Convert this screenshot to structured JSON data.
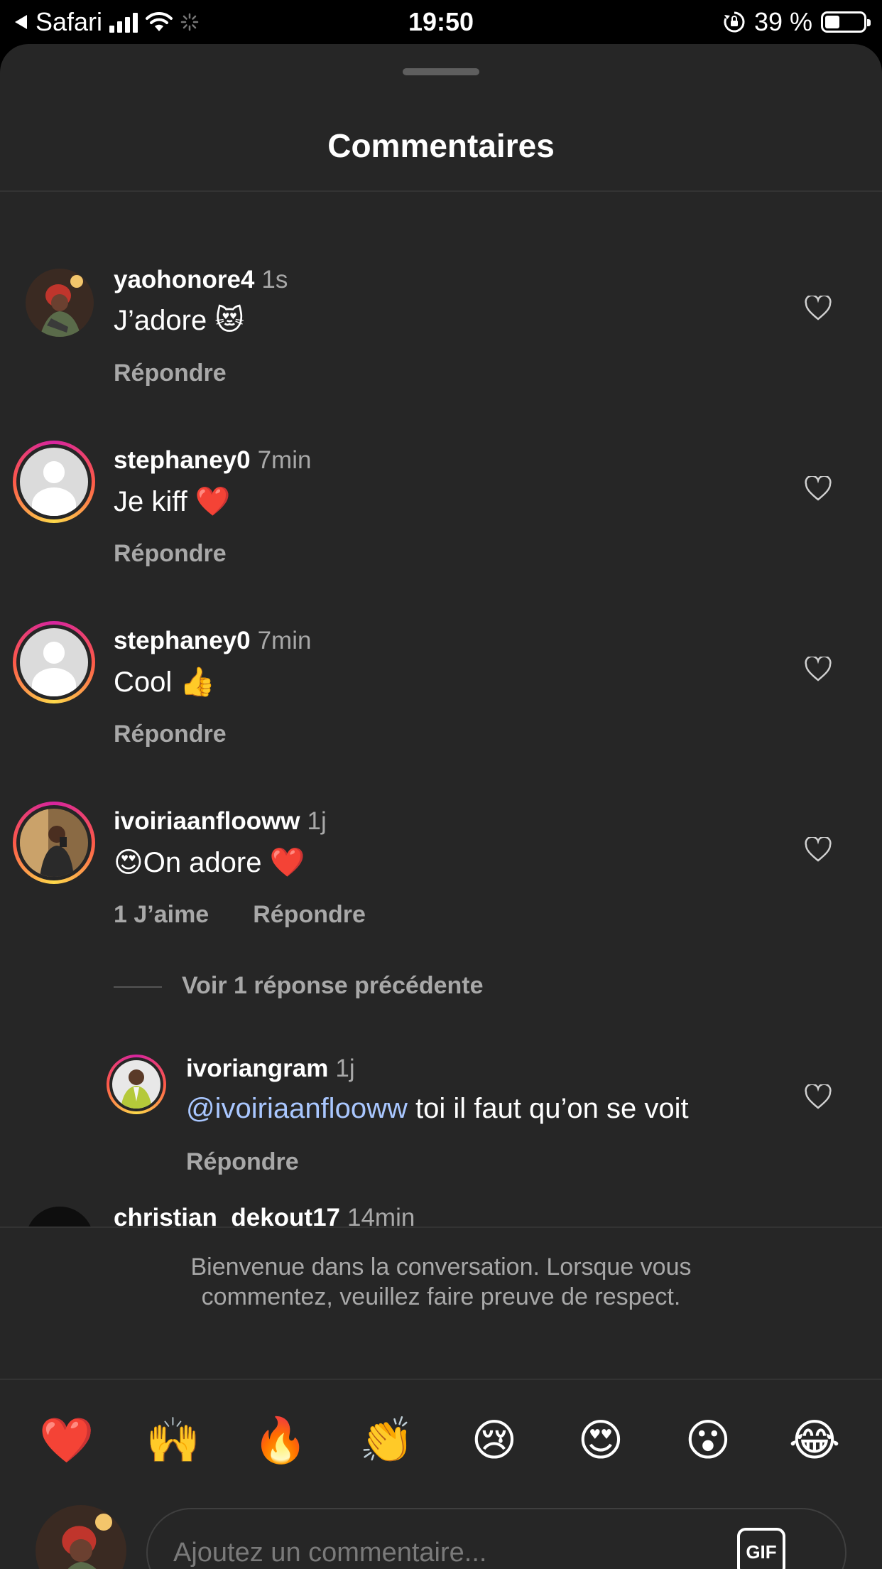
{
  "status_bar": {
    "back_app": "Safari",
    "time": "19:50",
    "battery_percent": "39 %",
    "battery_level": 0.39
  },
  "sheet": {
    "title": "Commentaires"
  },
  "comments": [
    {
      "username": "yaohonore4",
      "timestamp": "1s",
      "text": "J’adore",
      "emoji": "😻",
      "reply_label": "Répondre"
    },
    {
      "username": "stephaney0",
      "timestamp": "7min",
      "text": "Je kiff",
      "emoji": "❤️",
      "reply_label": "Répondre"
    },
    {
      "username": "stephaney0",
      "timestamp": "7min",
      "text": "Cool",
      "emoji": "👍",
      "reply_label": "Répondre"
    },
    {
      "username": "ivoiriaanflooww",
      "timestamp": "1j",
      "lead_emoji": "😍",
      "text": "On adore",
      "emoji": "❤️",
      "likes_label": "1 J’aime",
      "reply_label": "Répondre"
    },
    {
      "username": "christian_dekout17",
      "timestamp": "14min"
    }
  ],
  "view_replies_label": "Voir 1 réponse précédente",
  "reply": {
    "username": "ivoriangram",
    "timestamp": "1j",
    "mention": "@ivoiriaanflooww",
    "text": " toi il faut qu’on se voit",
    "reply_label": "Répondre"
  },
  "footer": {
    "welcome_line1": "Bienvenue dans la conversation. Lorsque vous",
    "welcome_line2": "commentez, veuillez faire preuve de respect.",
    "quick_emojis": [
      "❤️",
      "🙌",
      "🔥",
      "👏",
      "😢",
      "😍",
      "😮",
      "😂"
    ],
    "input_placeholder": "Ajoutez un commentaire...",
    "gif_label": "GIF"
  },
  "icons": {
    "back": "back-arrow-icon",
    "signal": "cellular-signal-icon",
    "wifi": "wifi-icon",
    "loading": "activity-spinner-icon",
    "rotation_lock": "rotation-lock-icon",
    "battery": "battery-icon",
    "like": "heart-icon"
  }
}
